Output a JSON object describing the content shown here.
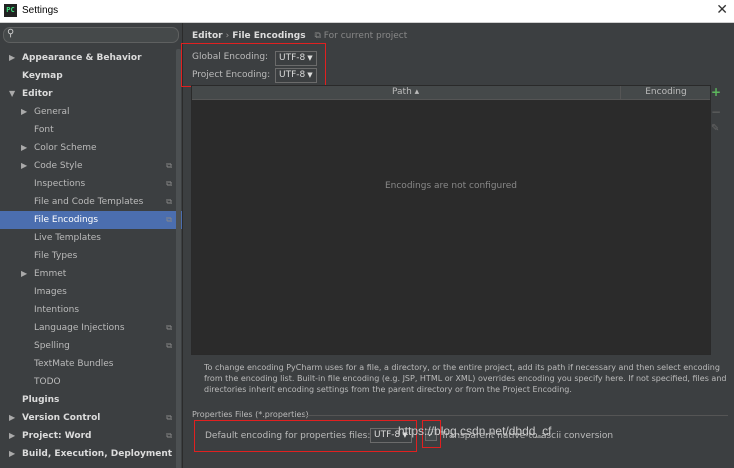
{
  "window": {
    "title": "Settings",
    "app_icon": "PC"
  },
  "sidebar": {
    "search_placeholder": "",
    "items": [
      {
        "label": "Appearance & Behavior",
        "bold": true,
        "arrow": "▶",
        "level": 0
      },
      {
        "label": "Keymap",
        "bold": true,
        "arrow": "",
        "level": 0
      },
      {
        "label": "Editor",
        "bold": true,
        "arrow": "▼",
        "level": 0
      },
      {
        "label": "General",
        "arrow": "▶",
        "level": 1
      },
      {
        "label": "Font",
        "arrow": "",
        "level": 1
      },
      {
        "label": "Color Scheme",
        "arrow": "▶",
        "level": 1
      },
      {
        "label": "Code Style",
        "arrow": "▶",
        "level": 1,
        "copy": true
      },
      {
        "label": "Inspections",
        "arrow": "",
        "level": 1,
        "copy": true
      },
      {
        "label": "File and Code Templates",
        "arrow": "",
        "level": 1,
        "copy": true
      },
      {
        "label": "File Encodings",
        "arrow": "",
        "level": 1,
        "copy": true,
        "selected": true
      },
      {
        "label": "Live Templates",
        "arrow": "",
        "level": 1
      },
      {
        "label": "File Types",
        "arrow": "",
        "level": 1
      },
      {
        "label": "Emmet",
        "arrow": "▶",
        "level": 1
      },
      {
        "label": "Images",
        "arrow": "",
        "level": 1
      },
      {
        "label": "Intentions",
        "arrow": "",
        "level": 1
      },
      {
        "label": "Language Injections",
        "arrow": "",
        "level": 1,
        "copy": true
      },
      {
        "label": "Spelling",
        "arrow": "",
        "level": 1,
        "copy": true
      },
      {
        "label": "TextMate Bundles",
        "arrow": "",
        "level": 1
      },
      {
        "label": "TODO",
        "arrow": "",
        "level": 1
      },
      {
        "label": "Plugins",
        "bold": true,
        "arrow": "",
        "level": 0
      },
      {
        "label": "Version Control",
        "bold": true,
        "arrow": "▶",
        "level": 0,
        "copy": true
      },
      {
        "label": "Project: Word",
        "bold": true,
        "arrow": "▶",
        "level": 0,
        "copy": true
      },
      {
        "label": "Build, Execution, Deployment",
        "bold": true,
        "arrow": "▶",
        "level": 0
      }
    ]
  },
  "breadcrumb": {
    "parent": "Editor",
    "separator": "›",
    "current": "File Encodings",
    "scope": "For current project"
  },
  "global_encoding": {
    "label": "Global Encoding:",
    "value": "UTF-8"
  },
  "project_encoding": {
    "label": "Project Encoding:",
    "value": "UTF-8"
  },
  "table": {
    "col_path": "Path ▴",
    "col_encoding": "Encoding",
    "empty_text": "Encodings are not configured"
  },
  "toolbar": {
    "add": "+",
    "remove": "−",
    "edit": "✎"
  },
  "description": "To change encoding PyCharm uses for a file, a directory, or the entire project, add its path if necessary and then select encoding from the encoding list. Built-in file encoding (e.g. JSP, HTML or XML) overrides encoding you specify here. If not specified, files and directories inherit encoding settings from the parent directory or from the Project Encoding.",
  "properties": {
    "section_title": "Properties Files (*.properties)",
    "default_label": "Default encoding for properties files:",
    "default_value": "UTF-8",
    "transparent_label": "Transparent native-to-ascii conversion",
    "transparent_checked": true
  },
  "watermark": "https://blog.csdn.net/dbdd_cf",
  "colors": {
    "selection": "#4b6eaf",
    "annotation_red": "#e02020",
    "add_green": "#5cb85c"
  }
}
